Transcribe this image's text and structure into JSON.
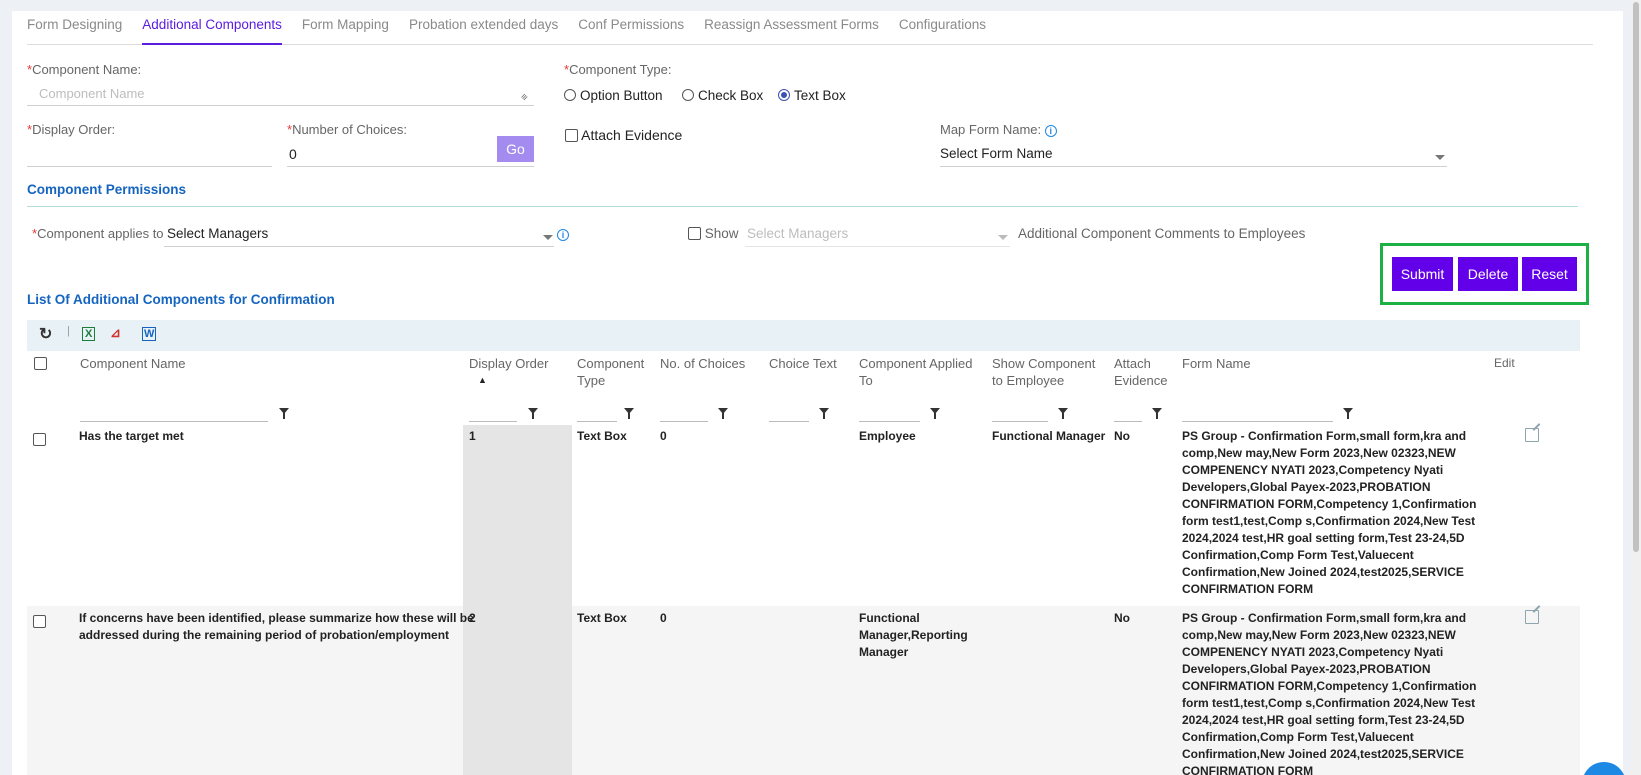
{
  "tabs": [
    "Form Designing",
    "Additional Components",
    "Form Mapping",
    "Probation extended days",
    "Conf Permissions",
    "Reassign Assessment Forms",
    "Configurations"
  ],
  "form": {
    "component_name_label": "Component Name:",
    "component_name_placeholder": "Component Name",
    "component_type_label": "Component Type:",
    "type_options": [
      "Option Button",
      "Check Box",
      "Text Box"
    ],
    "display_order_label": "Display Order:",
    "choices_label": "Number of Choices:",
    "choices_value": "0",
    "go_label": "Go",
    "attach_evidence_label": "Attach Evidence",
    "map_form_label": "Map Form Name:",
    "map_form_value": "Select Form Name"
  },
  "permissions": {
    "title": "Component Permissions",
    "applies_label": "Component applies to",
    "applies_value": "Select Managers",
    "show_label": "Show",
    "show_placeholder": "Select Managers",
    "comments_label": "Additional Component Comments to Employees"
  },
  "actions": {
    "submit": "Submit",
    "delete": "Delete",
    "reset": "Reset"
  },
  "list_title": "List Of Additional Components for Confirmation",
  "table": {
    "headers": {
      "name": "Component Name",
      "order": "Display Order",
      "type_1": "Component",
      "type_2": "Type",
      "choices": "No. of Choices",
      "choice_text": "Choice Text",
      "applied_1": "Component Applied",
      "applied_2": "To",
      "show_1": "Show Component",
      "show_2": "to Employee",
      "attach_1": "Attach",
      "attach_2": "Evidence",
      "form_name": "Form Name",
      "edit": "Edit"
    },
    "rows": [
      {
        "name_1": "Has the target met",
        "name_2": "",
        "order": "1",
        "type": "Text Box",
        "choices": "0",
        "applied_1": "Employee",
        "applied_2": "",
        "applied_3": "",
        "show": "Functional Manager",
        "attach": "No",
        "form_lines": [
          "PS Group - Confirmation Form,small form,kra and",
          "comp,New may,New Form 2023,New 02323,NEW",
          "COMPENENCY NYATI 2023,Competency Nyati",
          "Developers,Global Payex-2023,PROBATION",
          "CONFIRMATION FORM,Competency 1,Confirmation",
          "form test1,test,Comp s,Confirmation 2024,New Test",
          "2024,2024 test,HR goal setting form,Test 23-24,5D",
          "Confirmation,Comp Form Test,Valuecent",
          "Confirmation,New Joined 2024,test2025,SERVICE",
          "CONFIRMATION FORM"
        ]
      },
      {
        "name_1": "If concerns have been identified, please summarize how these will be",
        "name_2": "addressed during the remaining period of probation/employment",
        "order": "2",
        "type": "Text Box",
        "choices": "0",
        "applied_1": "Functional",
        "applied_2": "Manager,Reporting",
        "applied_3": "Manager",
        "show": "",
        "attach": "No",
        "form_lines": [
          "PS Group - Confirmation Form,small form,kra and",
          "comp,New may,New Form 2023,New 02323,NEW",
          "COMPENENCY NYATI 2023,Competency Nyati",
          "Developers,Global Payex-2023,PROBATION",
          "CONFIRMATION FORM,Competency 1,Confirmation",
          "form test1,test,Comp s,Confirmation 2024,New Test",
          "2024,2024 test,HR goal setting form,Test 23-24,5D",
          "Confirmation,Comp Form Test,Valuecent",
          "Confirmation,New Joined 2024,test2025,SERVICE",
          "CONFIRMATION FORM"
        ]
      }
    ]
  },
  "colors": {
    "accent": "#6200ea",
    "highlight": "#1db045",
    "link": "#1565c0"
  }
}
